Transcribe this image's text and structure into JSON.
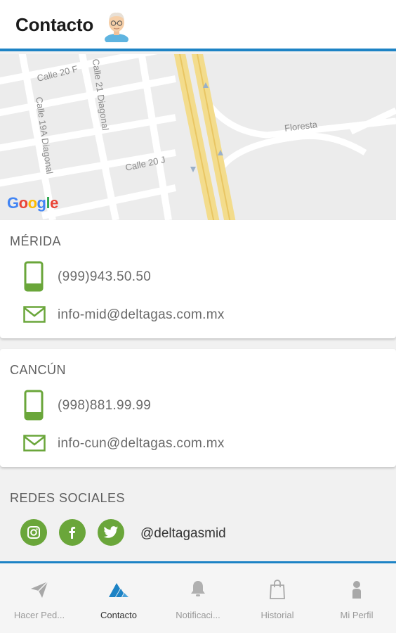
{
  "header": {
    "title": "Contacto"
  },
  "map": {
    "street_labels": [
      "Calle 20 F",
      "Calle 21 Diagonal",
      "Calle 19A Diagonal",
      "Calle 20 J",
      "Floresta"
    ],
    "provider": "Google"
  },
  "offices": [
    {
      "name": "MÉRIDA",
      "phone": "(999)943.50.50",
      "email": "info-mid@deltagas.com.mx"
    },
    {
      "name": "CANCÚN",
      "phone": "(998)881.99.99",
      "email": "info-cun@deltagas.com.mx"
    }
  ],
  "social": {
    "title": "REDES SOCIALES",
    "handle": "@deltagasmid",
    "networks": [
      "instagram",
      "facebook",
      "twitter"
    ]
  },
  "tabs": [
    {
      "label": "Hacer Ped...",
      "icon": "send-icon",
      "active": false
    },
    {
      "label": "Contacto",
      "icon": "deltagas-logo-icon",
      "active": true
    },
    {
      "label": "Notificaci...",
      "icon": "bell-icon",
      "active": false
    },
    {
      "label": "Historial",
      "icon": "shopping-bag-icon",
      "active": false
    },
    {
      "label": "Mi Perfil",
      "icon": "user-icon",
      "active": false
    }
  ],
  "colors": {
    "accent_blue": "#1d83c5",
    "accent_green": "#6aa63a"
  }
}
